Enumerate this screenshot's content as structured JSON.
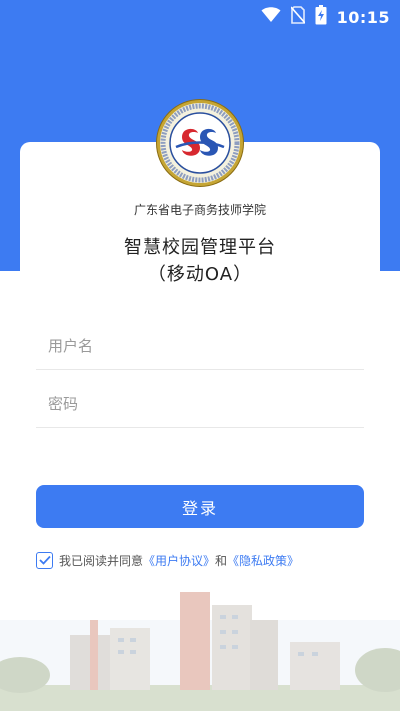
{
  "status_bar": {
    "time": "10:15",
    "icons": [
      "wifi-icon",
      "no-sim-icon",
      "battery-charging-icon"
    ]
  },
  "header": {
    "school_name": "广东省电子商务技师学院",
    "platform_title": "智慧校园管理平台",
    "platform_subtitle": "（移动OA）"
  },
  "form": {
    "username_placeholder": "用户名",
    "password_placeholder": "密码",
    "login_label": "登录"
  },
  "agreement": {
    "checked": true,
    "prefix": "我已阅读并同意",
    "user_agreement": "《用户协议》",
    "and": "和",
    "privacy_policy": "《隐私政策》"
  },
  "colors": {
    "brand": "#3d7bf2",
    "background": "#ffffff"
  }
}
